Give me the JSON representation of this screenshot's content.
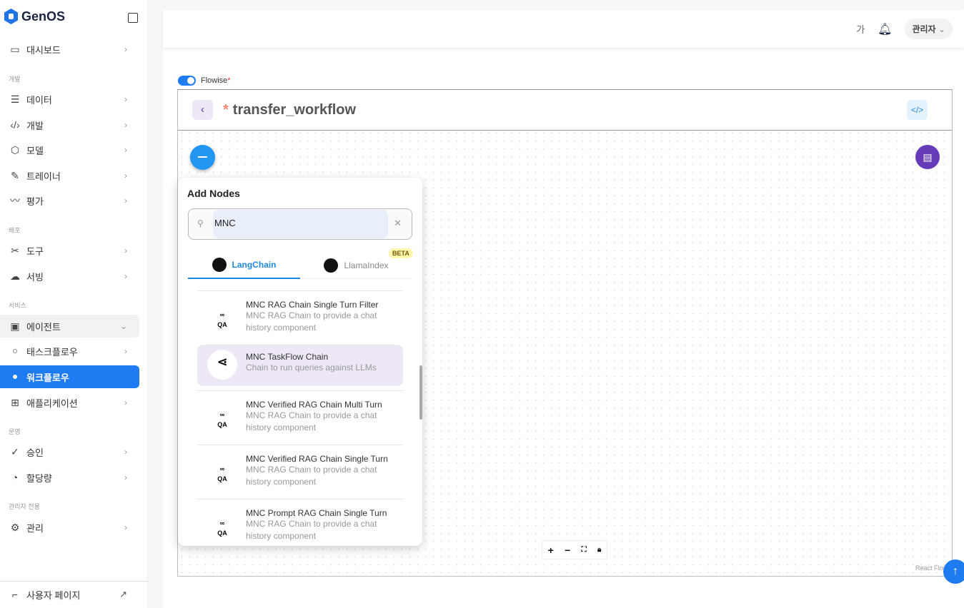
{
  "sidebar": {
    "brand": "GenOS",
    "items": [
      {
        "label": "대시보드",
        "icon": "monitor-icon"
      },
      {
        "section": "개발"
      },
      {
        "label": "데이터",
        "icon": "database-icon"
      },
      {
        "label": "개발",
        "icon": "code-icon"
      },
      {
        "label": "모델",
        "icon": "cube-icon"
      },
      {
        "label": "트레이너",
        "icon": "pencil-icon"
      },
      {
        "label": "평가",
        "icon": "chart-line-icon"
      },
      {
        "section": "배포"
      },
      {
        "label": "도구",
        "icon": "tools-icon"
      },
      {
        "label": "서빙",
        "icon": "cloud-icon"
      },
      {
        "section": "서비스"
      },
      {
        "label": "에이전트",
        "icon": "agent-icon"
      },
      {
        "label": "태스크플로우"
      },
      {
        "label": "워크플로우"
      },
      {
        "label": "애플리케이션",
        "icon": "apps-icon"
      },
      {
        "section": "운영"
      },
      {
        "label": "승인",
        "icon": "check-icon"
      },
      {
        "label": "할당량",
        "icon": "pie-icon"
      },
      {
        "section": "관리자 전용"
      },
      {
        "label": "관리",
        "icon": "gear-icon"
      }
    ],
    "user_page": "사용자 페이지"
  },
  "header": {
    "font_label": "가",
    "user": "관리자"
  },
  "flowise": {
    "label": "Flowise",
    "required": "*",
    "enabled": true
  },
  "canvas": {
    "title": "transfer_workflow",
    "unsaved_mark": "*",
    "attribution": "React Flow"
  },
  "add_nodes": {
    "title": "Add Nodes",
    "search_value": "MNC",
    "tabs": [
      {
        "label": "LangChain",
        "active": true
      },
      {
        "label": "LlamaIndex",
        "badge": "BETA"
      }
    ],
    "nodes": [
      {
        "name": "MNC RAG Chain Single Turn Filter",
        "desc": "MNC RAG Chain to provide a chat history component",
        "icon": "qa-chain-icon"
      },
      {
        "name": "MNC TaskFlow Chain",
        "desc": "Chain to run queries against LLMs",
        "icon": "share-nodes-icon",
        "selected": true
      },
      {
        "name": "MNC Verified RAG Chain Multi Turn",
        "desc": "MNC RAG Chain to provide a chat history component",
        "icon": "qa-chain-icon"
      },
      {
        "name": "MNC Verified RAG Chain Single Turn",
        "desc": "MNC RAG Chain to provide a chat history component",
        "icon": "qa-chain-icon"
      },
      {
        "name": "MNC Prompt RAG Chain Single Turn",
        "desc": "MNC RAG Chain to provide a chat history component",
        "icon": "qa-chain-icon"
      }
    ]
  },
  "colors": {
    "primary": "#1e7bf2",
    "purple": "#673ab7",
    "accent_star": "#f08a6e"
  }
}
